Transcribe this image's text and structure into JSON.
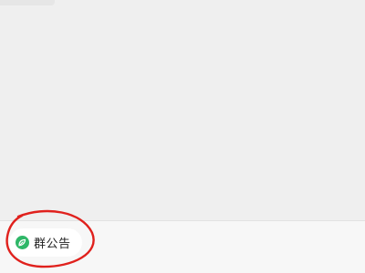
{
  "chat": {},
  "bottom_bar": {
    "announcement_chip": {
      "label": "群公告",
      "icon": "announcement-icon"
    }
  },
  "colors": {
    "background": "#efefef",
    "bar": "#f7f7f7",
    "chip": "#ffffff",
    "icon": "#2fb768",
    "annotation": "#e0211d"
  }
}
